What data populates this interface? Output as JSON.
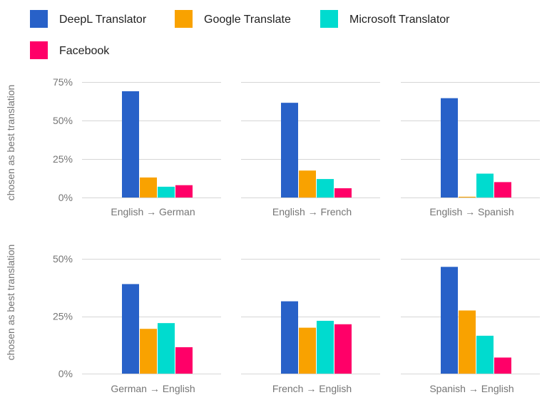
{
  "chart_data": {
    "type": "bar",
    "legend": {
      "placement": "top",
      "entries": [
        {
          "name": "DeepL Translator",
          "color": "#2861c8"
        },
        {
          "name": "Google Translate",
          "color": "#f9a200"
        },
        {
          "name": "Microsoft Translator",
          "color": "#00dbcf"
        },
        {
          "name": "Facebook",
          "color": "#ff0068"
        }
      ]
    },
    "rows": [
      {
        "ylabel": "chosen as best translation",
        "ylim": [
          0,
          75
        ],
        "ticks": [
          0,
          25,
          50,
          75
        ],
        "tick_labels": [
          "0%",
          "25%",
          "50%",
          "75%"
        ],
        "panels": [
          {
            "category": "English → German",
            "values": [
              69,
              13,
              7,
              8
            ]
          },
          {
            "category": "English → French",
            "values": [
              61.5,
              17.5,
              12,
              6
            ]
          },
          {
            "category": "English → Spanish",
            "values": [
              64.5,
              0.5,
              15.5,
              10
            ]
          }
        ]
      },
      {
        "ylabel": "chosen as best translation",
        "ylim": [
          0,
          50
        ],
        "ticks": [
          0,
          25,
          50
        ],
        "tick_labels": [
          "0%",
          "25%",
          "50%"
        ],
        "panels": [
          {
            "category": "German → English",
            "values": [
              39,
              19.5,
              22,
              11.5
            ]
          },
          {
            "category": "French → English",
            "values": [
              31.5,
              20,
              23,
              21.5
            ]
          },
          {
            "category": "Spanish → English",
            "values": [
              46.5,
              27.5,
              16.5,
              7
            ]
          }
        ]
      }
    ],
    "units": "%",
    "grid": true
  }
}
